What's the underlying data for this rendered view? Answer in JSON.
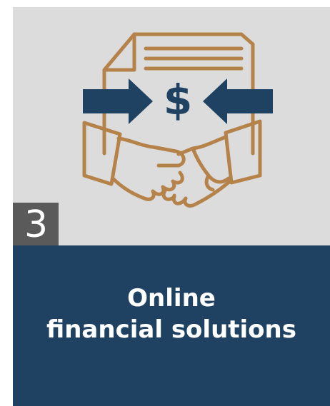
{
  "card": {
    "number": "3",
    "title_line1": "Online",
    "title_line2": "financial solutions"
  },
  "icon": {
    "name": "handshake-contract-dollar-icon",
    "glyph": "$"
  },
  "colors": {
    "top_background": "#dcdcdc",
    "bottom_background": "#1f4263",
    "icon_outline": "#b5834a",
    "arrows": "#1f4263",
    "badge_background": "#5a5a5a",
    "title_text": "#ffffff"
  }
}
